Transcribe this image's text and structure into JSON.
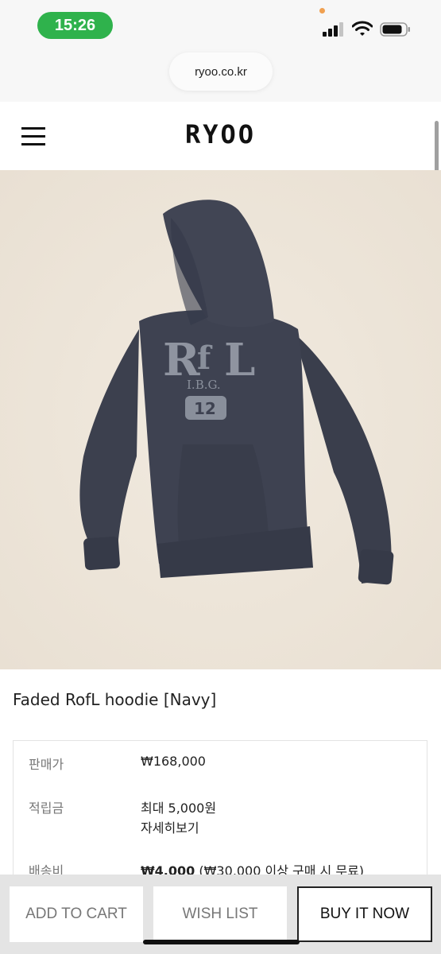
{
  "status_bar": {
    "time": "15:26",
    "icons": [
      "signal-icon",
      "wifi-icon",
      "battery-icon"
    ]
  },
  "browser": {
    "url": "ryoo.co.kr"
  },
  "header": {
    "logo": "RYOO",
    "menu_icon": "hamburger-menu-icon"
  },
  "product": {
    "image_graphic_text": [
      "RofL",
      "I.B.G.",
      "12"
    ],
    "title": "Faded RofL hoodie [Navy]",
    "info": {
      "price_label": "판매가",
      "price_value": "₩168,000",
      "points_label": "적립금",
      "points_value": "최대 5,000원",
      "points_detail": "자세히보기",
      "shipping_label": "배송비",
      "shipping_value": "₩4,000",
      "shipping_note": "(₩30,000 이상 구매 시 무료)"
    }
  },
  "actions": {
    "add_to_cart": "ADD TO CART",
    "wish_list": "WISH LIST",
    "buy_it_now": "BUY IT NOW"
  },
  "colors": {
    "time_pill": "#2fb24c",
    "image_background": "#efe7dc",
    "hoodie": "#3d4150"
  }
}
